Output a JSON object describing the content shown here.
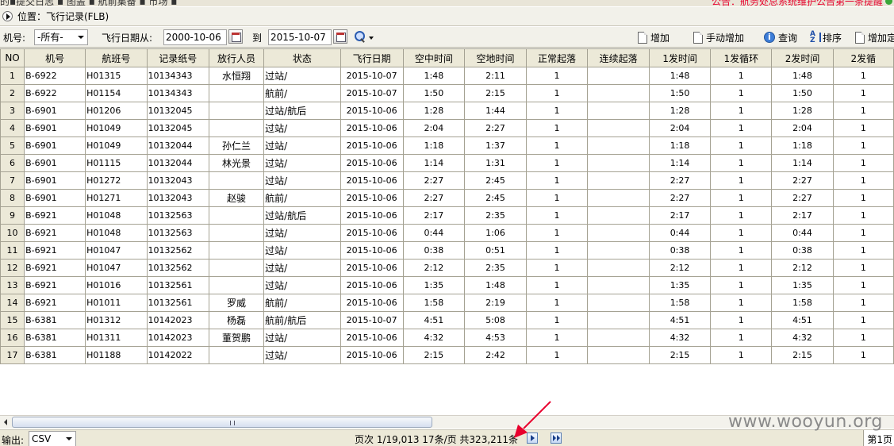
{
  "top_strip": {
    "left_text": "的▪提交日志 ▪ 图盖 ▪ 航前集备 ▪ 市场 ▪",
    "right_text": "公告：航务处总系统维护公告第一条提醒"
  },
  "location": {
    "text": "位置：飞行记录(FLB)"
  },
  "filters": {
    "aircraft_label": "机号:",
    "aircraft_value": "-所有-",
    "date_from_label": "飞行日期从:",
    "date_from": "2000-10-06",
    "to_label": "到",
    "date_to": "2015-10-07"
  },
  "toolbar": {
    "add": "增加",
    "manual_add": "手动增加",
    "query": "查询",
    "sort": "排序",
    "add_fixed": "增加定"
  },
  "table": {
    "columns": [
      "NO",
      "机号",
      "航班号",
      "记录纸号",
      "放行人员",
      "状态",
      "飞行日期",
      "空中时间",
      "空地时间",
      "正常起落",
      "连续起落",
      "1发时间",
      "1发循环",
      "2发时间",
      "2发循"
    ],
    "rows": [
      {
        "no": "1",
        "aircraft": "B-6922",
        "flight": "H01315",
        "log": "10134343",
        "releaser": "水恒翔",
        "status": "过站/",
        "date": "2015-10-07",
        "air": "1:48",
        "block": "2:11",
        "landings": "1",
        "cont": "",
        "e1t": "1:48",
        "e1c": "1",
        "e2t": "1:48",
        "e2c": "1"
      },
      {
        "no": "2",
        "aircraft": "B-6922",
        "flight": "H01154",
        "log": "10134343",
        "releaser": "",
        "status": "航前/",
        "date": "2015-10-07",
        "air": "1:50",
        "block": "2:15",
        "landings": "1",
        "cont": "",
        "e1t": "1:50",
        "e1c": "1",
        "e2t": "1:50",
        "e2c": "1"
      },
      {
        "no": "3",
        "aircraft": "B-6901",
        "flight": "H01206",
        "log": "10132045",
        "releaser": "",
        "status": "过站/航后",
        "date": "2015-10-06",
        "air": "1:28",
        "block": "1:44",
        "landings": "1",
        "cont": "",
        "e1t": "1:28",
        "e1c": "1",
        "e2t": "1:28",
        "e2c": "1"
      },
      {
        "no": "4",
        "aircraft": "B-6901",
        "flight": "H01049",
        "log": "10132045",
        "releaser": "",
        "status": "过站/",
        "date": "2015-10-06",
        "air": "2:04",
        "block": "2:27",
        "landings": "1",
        "cont": "",
        "e1t": "2:04",
        "e1c": "1",
        "e2t": "2:04",
        "e2c": "1"
      },
      {
        "no": "5",
        "aircraft": "B-6901",
        "flight": "H01049",
        "log": "10132044",
        "releaser": "孙仁兰",
        "status": "过站/",
        "date": "2015-10-06",
        "air": "1:18",
        "block": "1:37",
        "landings": "1",
        "cont": "",
        "e1t": "1:18",
        "e1c": "1",
        "e2t": "1:18",
        "e2c": "1"
      },
      {
        "no": "6",
        "aircraft": "B-6901",
        "flight": "H01115",
        "log": "10132044",
        "releaser": "林光景",
        "status": "过站/",
        "date": "2015-10-06",
        "air": "1:14",
        "block": "1:31",
        "landings": "1",
        "cont": "",
        "e1t": "1:14",
        "e1c": "1",
        "e2t": "1:14",
        "e2c": "1"
      },
      {
        "no": "7",
        "aircraft": "B-6901",
        "flight": "H01272",
        "log": "10132043",
        "releaser": "",
        "status": "过站/",
        "date": "2015-10-06",
        "air": "2:27",
        "block": "2:45",
        "landings": "1",
        "cont": "",
        "e1t": "2:27",
        "e1c": "1",
        "e2t": "2:27",
        "e2c": "1"
      },
      {
        "no": "8",
        "aircraft": "B-6901",
        "flight": "H01271",
        "log": "10132043",
        "releaser": "赵骏",
        "status": "航前/",
        "date": "2015-10-06",
        "air": "2:27",
        "block": "2:45",
        "landings": "1",
        "cont": "",
        "e1t": "2:27",
        "e1c": "1",
        "e2t": "2:27",
        "e2c": "1"
      },
      {
        "no": "9",
        "aircraft": "B-6921",
        "flight": "H01048",
        "log": "10132563",
        "releaser": "",
        "status": "过站/航后",
        "date": "2015-10-06",
        "air": "2:17",
        "block": "2:35",
        "landings": "1",
        "cont": "",
        "e1t": "2:17",
        "e1c": "1",
        "e2t": "2:17",
        "e2c": "1"
      },
      {
        "no": "10",
        "aircraft": "B-6921",
        "flight": "H01048",
        "log": "10132563",
        "releaser": "",
        "status": "过站/",
        "date": "2015-10-06",
        "air": "0:44",
        "block": "1:06",
        "landings": "1",
        "cont": "",
        "e1t": "0:44",
        "e1c": "1",
        "e2t": "0:44",
        "e2c": "1"
      },
      {
        "no": "11",
        "aircraft": "B-6921",
        "flight": "H01047",
        "log": "10132562",
        "releaser": "",
        "status": "过站/",
        "date": "2015-10-06",
        "air": "0:38",
        "block": "0:51",
        "landings": "1",
        "cont": "",
        "e1t": "0:38",
        "e1c": "1",
        "e2t": "0:38",
        "e2c": "1"
      },
      {
        "no": "12",
        "aircraft": "B-6921",
        "flight": "H01047",
        "log": "10132562",
        "releaser": "",
        "status": "过站/",
        "date": "2015-10-06",
        "air": "2:12",
        "block": "2:35",
        "landings": "1",
        "cont": "",
        "e1t": "2:12",
        "e1c": "1",
        "e2t": "2:12",
        "e2c": "1"
      },
      {
        "no": "13",
        "aircraft": "B-6921",
        "flight": "H01016",
        "log": "10132561",
        "releaser": "",
        "status": "过站/",
        "date": "2015-10-06",
        "air": "1:35",
        "block": "1:48",
        "landings": "1",
        "cont": "",
        "e1t": "1:35",
        "e1c": "1",
        "e2t": "1:35",
        "e2c": "1"
      },
      {
        "no": "14",
        "aircraft": "B-6921",
        "flight": "H01011",
        "log": "10132561",
        "releaser": "罗威",
        "status": "航前/",
        "date": "2015-10-06",
        "air": "1:58",
        "block": "2:19",
        "landings": "1",
        "cont": "",
        "e1t": "1:58",
        "e1c": "1",
        "e2t": "1:58",
        "e2c": "1"
      },
      {
        "no": "15",
        "aircraft": "B-6381",
        "flight": "H01312",
        "log": "10142023",
        "releaser": "杨磊",
        "status": "航前/航后",
        "date": "2015-10-07",
        "air": "4:51",
        "block": "5:08",
        "landings": "1",
        "cont": "",
        "e1t": "4:51",
        "e1c": "1",
        "e2t": "4:51",
        "e2c": "1"
      },
      {
        "no": "16",
        "aircraft": "B-6381",
        "flight": "H01311",
        "log": "10142023",
        "releaser": "董贺鹏",
        "status": "过站/",
        "date": "2015-10-06",
        "air": "4:32",
        "block": "4:53",
        "landings": "1",
        "cont": "",
        "e1t": "4:32",
        "e1c": "1",
        "e2t": "4:32",
        "e2c": "1"
      },
      {
        "no": "17",
        "aircraft": "B-6381",
        "flight": "H01188",
        "log": "10142022",
        "releaser": "",
        "status": "过站/",
        "date": "2015-10-06",
        "air": "2:15",
        "block": "2:42",
        "landings": "1",
        "cont": "",
        "e1t": "2:15",
        "e1c": "1",
        "e2t": "2:15",
        "e2c": "1"
      }
    ]
  },
  "statusbar": {
    "output_label": "输出:",
    "output_format": "CSV",
    "page_info": "页次 1/19,013 17条/页 共323,211条",
    "page_number": "第1页"
  },
  "watermark": "www.wooyun.org",
  "colors": {
    "header_bg": "#ece9d8",
    "grid_line": "#a5a293",
    "annotation_arrow": "#e8002d"
  }
}
